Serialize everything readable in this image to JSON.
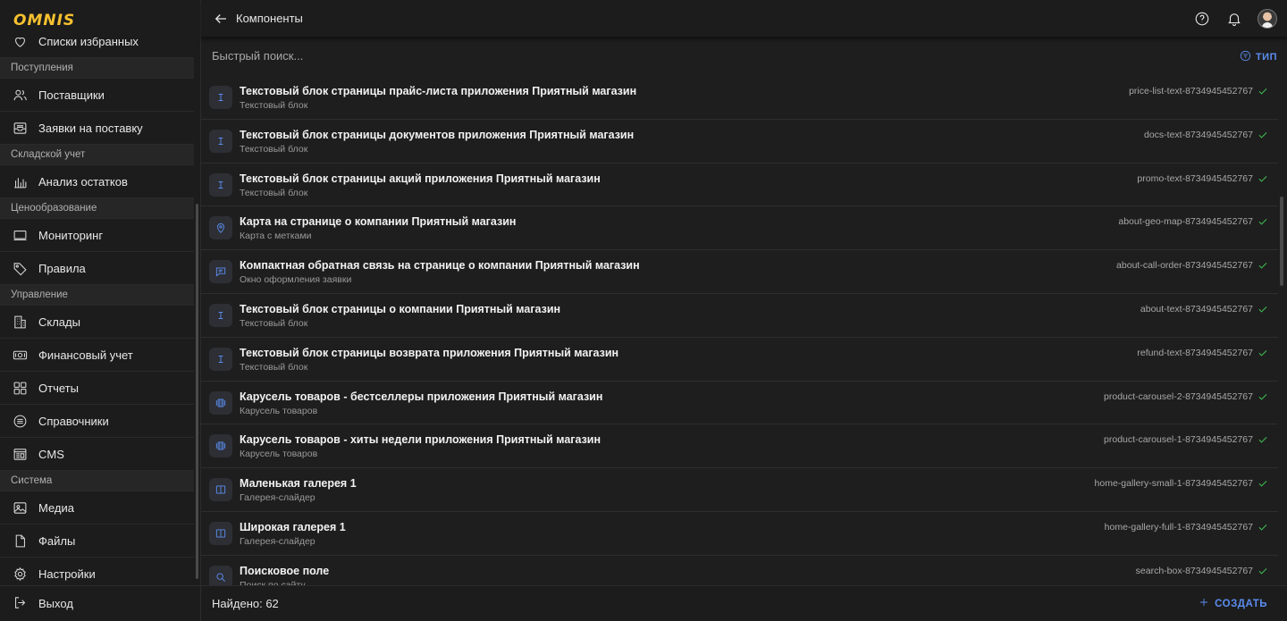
{
  "brand": {
    "logo": "OMNIS",
    "color": "#f6c12f"
  },
  "header": {
    "title": "Компоненты",
    "help_icon": "help-circle-icon",
    "bell_icon": "bell-icon"
  },
  "search": {
    "placeholder": "Быстрый поиск...",
    "filter_label": "ТИП"
  },
  "sidebar": {
    "partial_item": "Списки избранных",
    "groups": [
      {
        "title": "Поступления",
        "items": [
          "Поставщики",
          "Заявки на поставку"
        ]
      },
      {
        "title": "Складской учет",
        "items": [
          "Анализ остатков"
        ]
      },
      {
        "title": "Ценообразование",
        "items": [
          "Мониторинг",
          "Правила"
        ]
      },
      {
        "title": "Управление",
        "items": [
          "Склады",
          "Финансовый учет",
          "Отчеты",
          "Справочники",
          "CMS"
        ]
      },
      {
        "title": "Система",
        "items": [
          "Медиа",
          "Файлы",
          "Настройки"
        ]
      }
    ],
    "logout": "Выход"
  },
  "components": [
    {
      "title": "Текстовый блок страницы прайс-листа приложения Приятный магазин",
      "type": "Текстовый блок",
      "slug": "price-list-text-8734945452767",
      "icon": "text-icon"
    },
    {
      "title": "Текстовый блок страницы документов приложения Приятный магазин",
      "type": "Текстовый блок",
      "slug": "docs-text-8734945452767",
      "icon": "text-icon"
    },
    {
      "title": "Текстовый блок страницы акций приложения Приятный магазин",
      "type": "Текстовый блок",
      "slug": "promo-text-8734945452767",
      "icon": "text-icon"
    },
    {
      "title": "Карта на странице о компании Приятный магазин",
      "type": "Карта с метками",
      "slug": "about-geo-map-8734945452767",
      "icon": "map-pin-icon"
    },
    {
      "title": "Компактная обратная связь на странице о компании Приятный магазин",
      "type": "Окно оформления заявки",
      "slug": "about-call-order-8734945452767",
      "icon": "message-icon"
    },
    {
      "title": "Текстовый блок страницы о компании Приятный магазин",
      "type": "Текстовый блок",
      "slug": "about-text-8734945452767",
      "icon": "text-icon"
    },
    {
      "title": "Текстовый блок страницы возврата приложения Приятный магазин",
      "type": "Текстовый блок",
      "slug": "refund-text-8734945452767",
      "icon": "text-icon"
    },
    {
      "title": "Карусель товаров - бестселлеры приложения Приятный магазин",
      "type": "Карусель товаров",
      "slug": "product-carousel-2-8734945452767",
      "icon": "carousel-icon"
    },
    {
      "title": "Карусель товаров - хиты недели приложения Приятный магазин",
      "type": "Карусель товаров",
      "slug": "product-carousel-1-8734945452767",
      "icon": "carousel-icon"
    },
    {
      "title": "Маленькая галерея 1",
      "type": "Галерея-слайдер",
      "slug": "home-gallery-small-1-8734945452767",
      "icon": "gallery-icon"
    },
    {
      "title": "Широкая галерея 1",
      "type": "Галерея-слайдер",
      "slug": "home-gallery-full-1-8734945452767",
      "icon": "gallery-icon"
    },
    {
      "title": "Поисковое поле",
      "type": "Поиск по сайту",
      "slug": "search-box-8734945452767",
      "icon": "search-icon"
    }
  ],
  "footer": {
    "found_label": "Найдено: 62",
    "create_label": "СОЗДАТЬ"
  },
  "colors": {
    "accent": "#5b8def",
    "success": "#3fb950",
    "background": "#1e1e1e"
  }
}
